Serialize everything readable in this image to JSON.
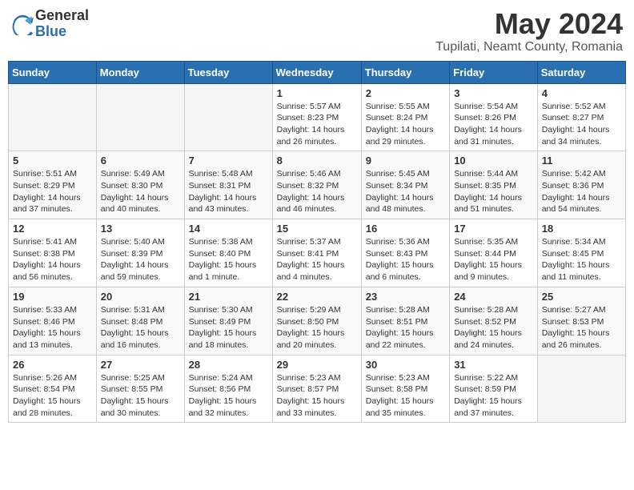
{
  "logo": {
    "general": "General",
    "blue": "Blue"
  },
  "title": "May 2024",
  "location": "Tupilati, Neamt County, Romania",
  "weekdays": [
    "Sunday",
    "Monday",
    "Tuesday",
    "Wednesday",
    "Thursday",
    "Friday",
    "Saturday"
  ],
  "weeks": [
    [
      {
        "day": "",
        "info": ""
      },
      {
        "day": "",
        "info": ""
      },
      {
        "day": "",
        "info": ""
      },
      {
        "day": "1",
        "info": "Sunrise: 5:57 AM\nSunset: 8:23 PM\nDaylight: 14 hours\nand 26 minutes."
      },
      {
        "day": "2",
        "info": "Sunrise: 5:55 AM\nSunset: 8:24 PM\nDaylight: 14 hours\nand 29 minutes."
      },
      {
        "day": "3",
        "info": "Sunrise: 5:54 AM\nSunset: 8:26 PM\nDaylight: 14 hours\nand 31 minutes."
      },
      {
        "day": "4",
        "info": "Sunrise: 5:52 AM\nSunset: 8:27 PM\nDaylight: 14 hours\nand 34 minutes."
      }
    ],
    [
      {
        "day": "5",
        "info": "Sunrise: 5:51 AM\nSunset: 8:29 PM\nDaylight: 14 hours\nand 37 minutes."
      },
      {
        "day": "6",
        "info": "Sunrise: 5:49 AM\nSunset: 8:30 PM\nDaylight: 14 hours\nand 40 minutes."
      },
      {
        "day": "7",
        "info": "Sunrise: 5:48 AM\nSunset: 8:31 PM\nDaylight: 14 hours\nand 43 minutes."
      },
      {
        "day": "8",
        "info": "Sunrise: 5:46 AM\nSunset: 8:32 PM\nDaylight: 14 hours\nand 46 minutes."
      },
      {
        "day": "9",
        "info": "Sunrise: 5:45 AM\nSunset: 8:34 PM\nDaylight: 14 hours\nand 48 minutes."
      },
      {
        "day": "10",
        "info": "Sunrise: 5:44 AM\nSunset: 8:35 PM\nDaylight: 14 hours\nand 51 minutes."
      },
      {
        "day": "11",
        "info": "Sunrise: 5:42 AM\nSunset: 8:36 PM\nDaylight: 14 hours\nand 54 minutes."
      }
    ],
    [
      {
        "day": "12",
        "info": "Sunrise: 5:41 AM\nSunset: 8:38 PM\nDaylight: 14 hours\nand 56 minutes."
      },
      {
        "day": "13",
        "info": "Sunrise: 5:40 AM\nSunset: 8:39 PM\nDaylight: 14 hours\nand 59 minutes."
      },
      {
        "day": "14",
        "info": "Sunrise: 5:38 AM\nSunset: 8:40 PM\nDaylight: 15 hours\nand 1 minute."
      },
      {
        "day": "15",
        "info": "Sunrise: 5:37 AM\nSunset: 8:41 PM\nDaylight: 15 hours\nand 4 minutes."
      },
      {
        "day": "16",
        "info": "Sunrise: 5:36 AM\nSunset: 8:43 PM\nDaylight: 15 hours\nand 6 minutes."
      },
      {
        "day": "17",
        "info": "Sunrise: 5:35 AM\nSunset: 8:44 PM\nDaylight: 15 hours\nand 9 minutes."
      },
      {
        "day": "18",
        "info": "Sunrise: 5:34 AM\nSunset: 8:45 PM\nDaylight: 15 hours\nand 11 minutes."
      }
    ],
    [
      {
        "day": "19",
        "info": "Sunrise: 5:33 AM\nSunset: 8:46 PM\nDaylight: 15 hours\nand 13 minutes."
      },
      {
        "day": "20",
        "info": "Sunrise: 5:31 AM\nSunset: 8:48 PM\nDaylight: 15 hours\nand 16 minutes."
      },
      {
        "day": "21",
        "info": "Sunrise: 5:30 AM\nSunset: 8:49 PM\nDaylight: 15 hours\nand 18 minutes."
      },
      {
        "day": "22",
        "info": "Sunrise: 5:29 AM\nSunset: 8:50 PM\nDaylight: 15 hours\nand 20 minutes."
      },
      {
        "day": "23",
        "info": "Sunrise: 5:28 AM\nSunset: 8:51 PM\nDaylight: 15 hours\nand 22 minutes."
      },
      {
        "day": "24",
        "info": "Sunrise: 5:28 AM\nSunset: 8:52 PM\nDaylight: 15 hours\nand 24 minutes."
      },
      {
        "day": "25",
        "info": "Sunrise: 5:27 AM\nSunset: 8:53 PM\nDaylight: 15 hours\nand 26 minutes."
      }
    ],
    [
      {
        "day": "26",
        "info": "Sunrise: 5:26 AM\nSunset: 8:54 PM\nDaylight: 15 hours\nand 28 minutes."
      },
      {
        "day": "27",
        "info": "Sunrise: 5:25 AM\nSunset: 8:55 PM\nDaylight: 15 hours\nand 30 minutes."
      },
      {
        "day": "28",
        "info": "Sunrise: 5:24 AM\nSunset: 8:56 PM\nDaylight: 15 hours\nand 32 minutes."
      },
      {
        "day": "29",
        "info": "Sunrise: 5:23 AM\nSunset: 8:57 PM\nDaylight: 15 hours\nand 33 minutes."
      },
      {
        "day": "30",
        "info": "Sunrise: 5:23 AM\nSunset: 8:58 PM\nDaylight: 15 hours\nand 35 minutes."
      },
      {
        "day": "31",
        "info": "Sunrise: 5:22 AM\nSunset: 8:59 PM\nDaylight: 15 hours\nand 37 minutes."
      },
      {
        "day": "",
        "info": ""
      }
    ]
  ]
}
